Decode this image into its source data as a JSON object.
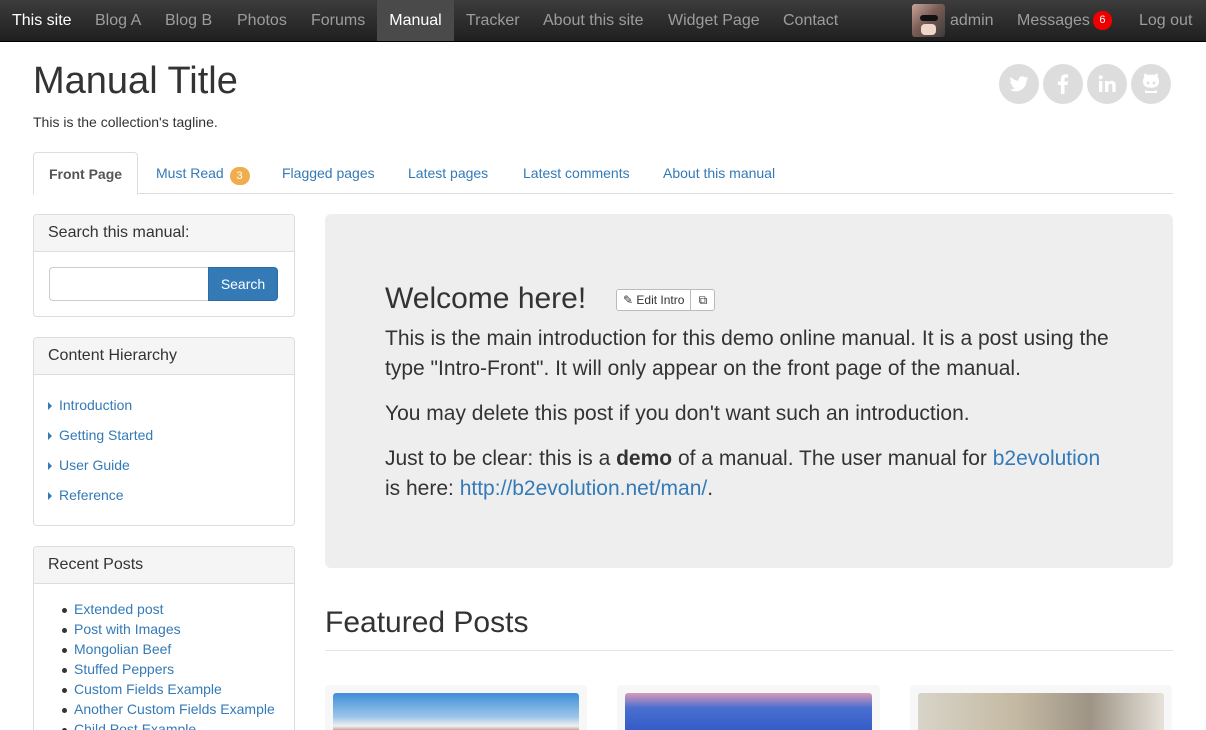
{
  "nav": {
    "site": "This site",
    "items": [
      "Blog A",
      "Blog B",
      "Photos",
      "Forums",
      "Manual",
      "Tracker",
      "About this site",
      "Widget Page",
      "Contact"
    ],
    "user": "admin",
    "messages_label": "Messages",
    "messages_count": "6",
    "logout": "Log out"
  },
  "header": {
    "title": "Manual Title",
    "tagline": "This is the collection's tagline.",
    "social_icons": [
      "twitter-icon",
      "facebook-icon",
      "linkedin-icon",
      "github-icon"
    ]
  },
  "tabs": {
    "front": "Front Page",
    "must_read": "Must Read",
    "must_read_count": "3",
    "flagged": "Flagged pages",
    "latest_pages": "Latest pages",
    "latest_comments": "Latest comments",
    "about": "About this manual"
  },
  "search": {
    "title": "Search this manual:",
    "button": "Search",
    "value": ""
  },
  "hierarchy": {
    "title": "Content Hierarchy",
    "items": [
      "Introduction",
      "Getting Started",
      "User Guide",
      "Reference"
    ]
  },
  "recent": {
    "title": "Recent Posts",
    "items": [
      "Extended post",
      "Post with Images",
      "Mongolian Beef",
      "Stuffed Peppers",
      "Custom Fields Example",
      "Another Custom Fields Example",
      "Child Post Example"
    ]
  },
  "intro": {
    "title": "Welcome here!",
    "edit_label": "Edit Intro",
    "p1": "This is the main introduction for this demo online manual. It is a post using the type \"Intro-Front\". It will only appear on the front page of the manual.",
    "p2": "You may delete this post if you don't want such an introduction.",
    "p3_a": "Just to be clear: this is a ",
    "p3_bold": "demo",
    "p3_b": " of a manual. The user manual for ",
    "p3_link1": "b2evolution",
    "p3_c": " is here: ",
    "p3_link2": "http://b2evolution.net/man/",
    "p3_d": "."
  },
  "featured": {
    "title": "Featured Posts"
  },
  "colors": {
    "link": "#337ab7",
    "nav_bg": "#2d2d2d",
    "badge_red": "#ee0000",
    "badge_orange": "#f0ad4e",
    "intro_bg": "#eeeeee"
  }
}
